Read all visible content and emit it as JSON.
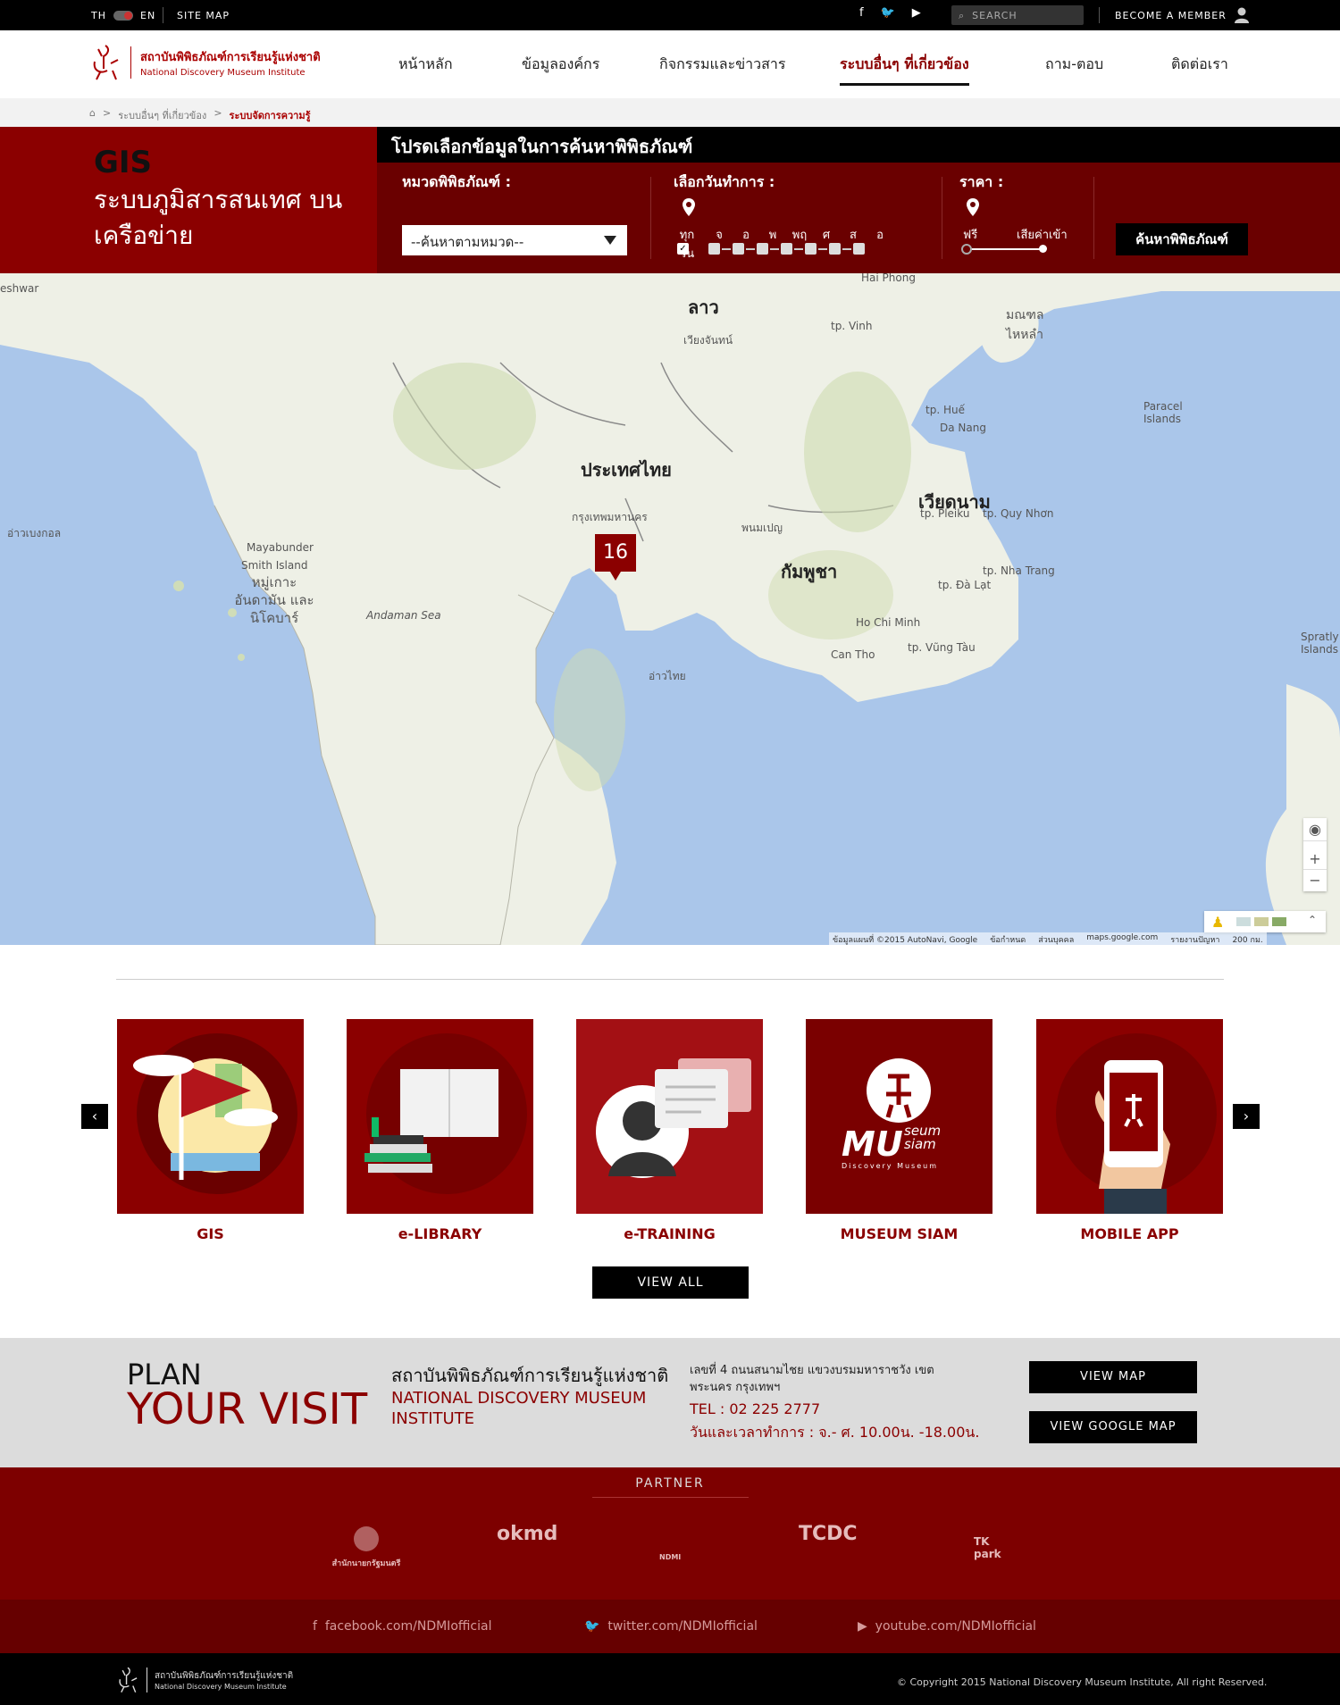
{
  "topbar": {
    "lang_th": "TH",
    "lang_en": "EN",
    "sitemap": "SITE MAP",
    "search_placeholder": "SEARCH",
    "member": "BECOME A MEMBER"
  },
  "logo": {
    "th": "สถาบันพิพิธภัณฑ์การเรียนรู้แห่งชาติ",
    "en": "National Discovery Museum Institute"
  },
  "nav": [
    "หน้าหลัก",
    "ข้อมูลองค์กร",
    "กิจกรรมและข่าวสาร",
    "ระบบอื่นๆ ที่เกี่ยวข้อง",
    "ถาม-ตอบ",
    "ติดต่อเรา"
  ],
  "breadcrumb": [
    "ระบบอื่นๆ ที่เกี่ยวข้อง",
    "ระบบจัดการความรู้"
  ],
  "hero": {
    "title": "GIS",
    "subtitle": "ระบบภูมิสารสนเทศ บนเครือข่าย",
    "filter_bar": "โปรดเลือกข้อมูลในการค้นหาพิพิธภัณฑ์",
    "category_label": "หมวดพิพิธภัณฑ์ :",
    "category_value": "--ค้นหาตามหมวด--",
    "date_label": "เลือกวันทำการ :",
    "days": [
      "ทุกวัน",
      "จ",
      "อ",
      "พ",
      "พฤ",
      "ศ",
      "ส",
      "อ"
    ],
    "price_label": "ราคา :",
    "price_free": "ฟรี",
    "price_paid": "เสียค่าเข้า",
    "search_button": "ค้นหาพิพิธภัณฑ์"
  },
  "map": {
    "cluster_count": "16",
    "labels": {
      "laos": "ลาว",
      "thailand": "ประเทศไทย",
      "vietnam": "เวียดนาม",
      "cambodia": "กัมพูชา",
      "hainan": "มณฑล ไหหลำ",
      "haiphong": "Hai Phong",
      "vinh": "tp. Vinh",
      "hue": "tp. Huế",
      "danang": "Da Nang",
      "pleiku": "tp. Pleiku",
      "quynhon": "tp. Quy Nhơn",
      "nhatrang": "tp. Nha Trang",
      "dalat": "tp. Đà Lạt",
      "hcm": "Ho Chi Minh",
      "cantho": "Can Tho",
      "vungtau": "tp. Vũng Tàu",
      "paracel": "Paracel Islands",
      "spratly": "Spratly Islands",
      "andaman_sea": "Andaman Sea",
      "andaman_islands": "หมู่เกาะ อันดามัน และนิโคบาร์",
      "mayabunder": "Mayabunder",
      "smith": "Smith Island",
      "bay": "อ่าวเบงกอล",
      "gulf": "อ่าวไทย",
      "eshwar": "eshwar",
      "bangkok": "กรุงเทพมหานคร",
      "phnompenh": "พนมเปญ",
      "vientiane": "เวียงจันทน์"
    },
    "attribution": [
      "ข้อมูลแผนที่ ©2015 AutoNavi, Google",
      "ข้อกำหนด",
      "ส่วนบุคคล",
      "maps.google.com",
      "รายงานปัญหา",
      "200 กม."
    ]
  },
  "services": [
    {
      "label": "GIS",
      "icon": "map-flag-icon"
    },
    {
      "label": "e-LIBRARY",
      "icon": "books-icon"
    },
    {
      "label": "e-TRAINING",
      "icon": "chat-person-icon"
    },
    {
      "label": "MUSEUM SIAM",
      "icon": "museum-siam-logo-icon"
    },
    {
      "label": "MOBILE APP",
      "icon": "phone-icon"
    }
  ],
  "museum_siam_logo": {
    "mu": "MU",
    "seum": "seum",
    "siam": "siam",
    "tag": "Discovery Museum"
  },
  "view_all": "VIEW ALL",
  "plan": {
    "line1": "PLAN",
    "line2": "YOUR VISIT",
    "name_th": "สถาบันพิพิธภัณฑ์การเรียนรู้แห่งชาติ",
    "name_en": "NATIONAL DISCOVERY MUSEUM INSTITUTE",
    "address": "เลขที่ 4 ถนนสนามไชย แขวงบรมมหาราชวัง เขตพระนคร กรุงเทพฯ",
    "tel": "TEL : 02 225 2777",
    "hours": "วันและเวลาทำการ : จ.- ศ. 10.00น. -18.00น.",
    "view_map": "VIEW MAP",
    "view_google_map": "VIEW GOOGLE MAP"
  },
  "partner": {
    "title": "PARTNER",
    "logos": [
      "สำนักนายกรัฐมนตรี",
      "okmd",
      "NDMI",
      "TCDC",
      "TK park"
    ]
  },
  "social": [
    "facebook.com/NDMIofficial",
    "twitter.com/NDMIofficial",
    "youtube.com/NDMIofficial"
  ],
  "footer": {
    "copyright": "© Copyright 2015 National Discovery Museum Institute, All right Reserved.",
    "logo_th": "สถาบันพิพิธภัณฑ์การเรียนรู้แห่งชาติ",
    "logo_en": "National Discovery Museum Institute"
  },
  "colors": {
    "brand": "#8b0000",
    "dark": "#000000"
  }
}
